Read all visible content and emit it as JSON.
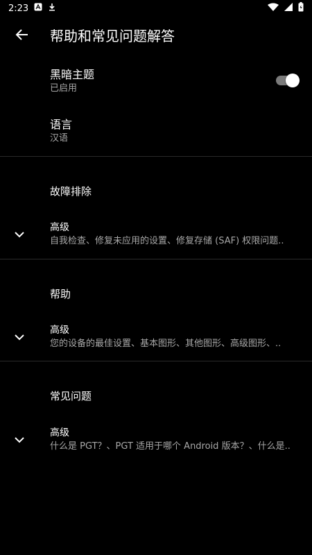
{
  "status_bar": {
    "time": "2:23"
  },
  "appbar": {
    "title": "帮助和常见问题解答"
  },
  "theme": {
    "title": "黑暗主题",
    "summary": "已启用",
    "enabled": true
  },
  "language": {
    "title": "语言",
    "summary": "汉语"
  },
  "sections": [
    {
      "category": "故障排除",
      "item_title": "高级",
      "item_summary": "自我检查、修复未应用的设置、修复存储 (SAF) 权限问题.."
    },
    {
      "category": "帮助",
      "item_title": "高级",
      "item_summary": "您的设备的最佳设置、基本图形、其他图形、高级图形、.."
    },
    {
      "category": "常见问题",
      "item_title": "高级",
      "item_summary": "什么是 PGT？、PGT 适用于哪个 Android 版本？、什么是.."
    }
  ]
}
